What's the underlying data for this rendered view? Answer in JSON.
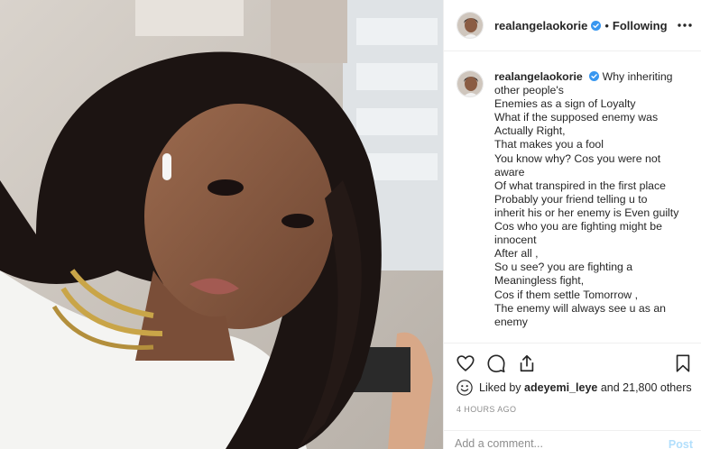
{
  "post": {
    "photo_icon": "selfie-photo",
    "header": {
      "username": "realangelaokorie",
      "separator": "•",
      "follow_status": "Following",
      "verified_icon": "verified-badge-icon",
      "more_icon": "more-options-icon"
    },
    "caption": {
      "username": "realangelaokorie",
      "lines": [
        "Why inheriting",
        "other people's",
        "Enemies as a sign of Loyalty",
        "What if the supposed enemy was",
        "Actually Right,",
        "That makes you a fool",
        "You know why? Cos you were not",
        "aware",
        "Of what transpired in the first place",
        "Probably your friend telling u to",
        "inherit his or her enemy is Even guilty",
        "Cos who you are fighting might be",
        "innocent",
        "After all ,",
        "So u see? you are fighting a",
        "Meaningless fight,",
        "Cos if them settle Tomorrow ,",
        "The enemy will always see u as an",
        "enemy"
      ]
    },
    "actions": {
      "like_icon": "heart-icon",
      "comment_icon": "comment-icon",
      "share_icon": "share-icon",
      "save_icon": "bookmark-icon"
    },
    "likes": {
      "prefix": "Liked by",
      "user": "adeyemi_leye",
      "suffix": "and 21,800 others"
    },
    "timestamp": "4 HOURS AGO",
    "comment": {
      "placeholder": "Add a comment...",
      "post_label": "Post"
    },
    "colors": {
      "verified": "#3897f0",
      "post_button_disabled": "#b2dffc",
      "border": "#efefef",
      "muted_text": "#8e8e8e"
    }
  }
}
